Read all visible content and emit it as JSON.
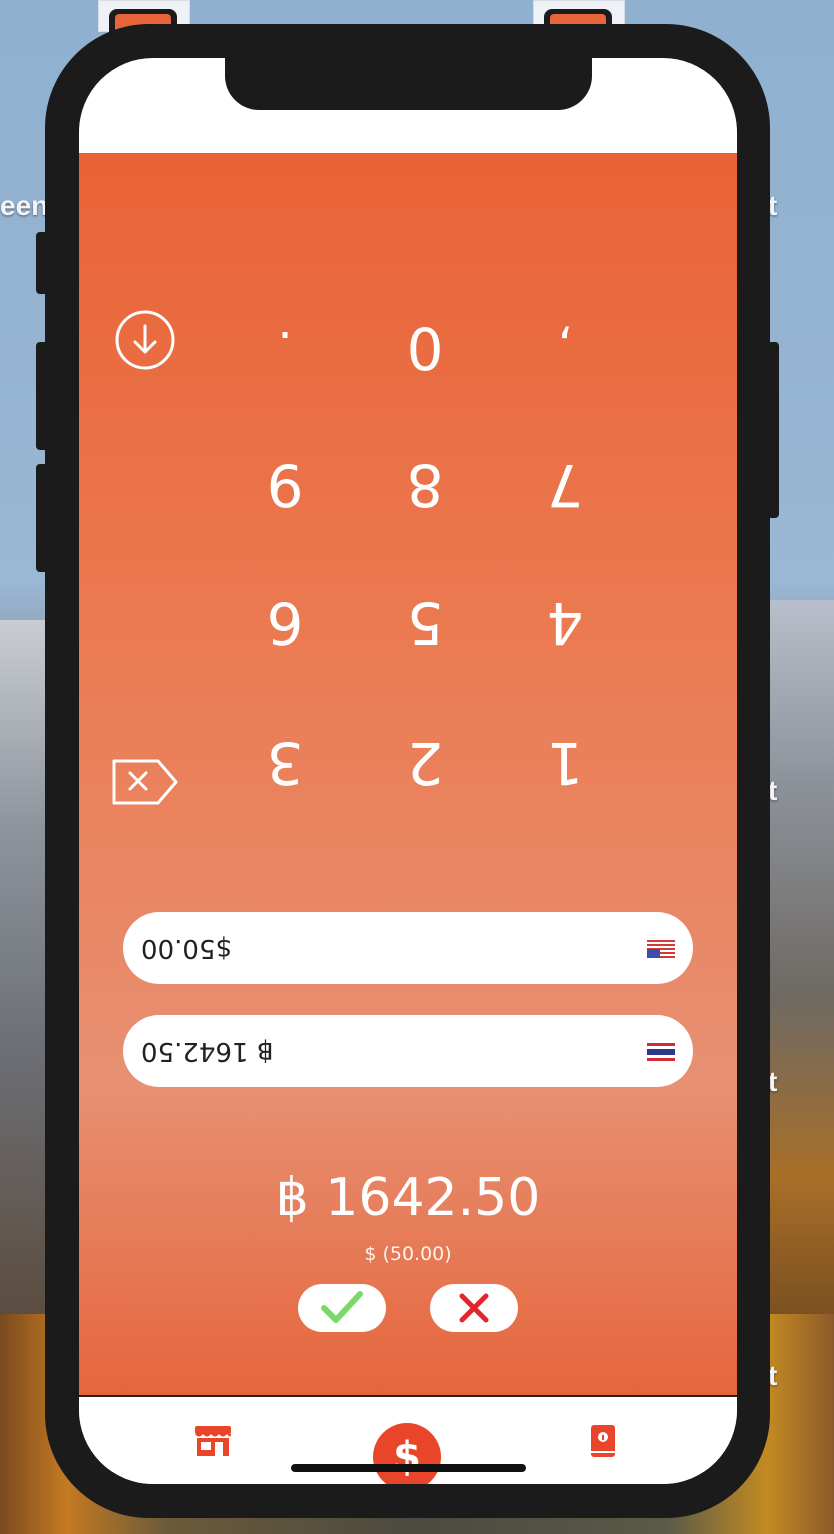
{
  "desktop": {
    "labels": [
      "een",
      "t",
      "t",
      "t",
      "t",
      "t"
    ]
  },
  "keypad": {
    "row0": [
      ".",
      "0",
      ","
    ],
    "row1": [
      "9",
      "8",
      "7"
    ],
    "row2": [
      "6",
      "5",
      "4"
    ],
    "row3": [
      "3",
      "2",
      "1"
    ],
    "download_icon": "arrow-down-circle-icon",
    "backspace_icon": "backspace-icon"
  },
  "fields": {
    "usd_value": "$50.00",
    "thb_value": "฿ 1642.50",
    "usd_flag": "us-flag-icon",
    "thb_flag": "thai-flag-icon"
  },
  "result": {
    "amount": "฿ 1642.50",
    "source": "$ (50.00)"
  },
  "actions": {
    "confirm_icon": "checkmark-icon",
    "cancel_icon": "close-icon",
    "confirm_color": "#7bd86a",
    "cancel_color": "#e3262d"
  },
  "tabbar": {
    "items": [
      "store-icon",
      "dollar-icon",
      "info-book-icon"
    ],
    "accent": "#e8452a"
  }
}
